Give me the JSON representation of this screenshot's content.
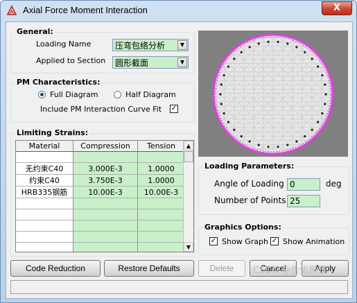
{
  "window": {
    "title": "Axial Force Moment Interaction",
    "close_glyph": "X"
  },
  "general": {
    "legend": "General:",
    "loading_name_label": "Loading Name",
    "loading_name_value": "压弯包络分析",
    "applied_section_label": "Applied to Section",
    "applied_section_value": "圆形截面"
  },
  "pm": {
    "legend": "PM Characteristics:",
    "full_label": "Full Diagram",
    "half_label": "Half Diagram",
    "selected": "full",
    "include_label": "Include PM Interaction Curve Fit",
    "include_checked": true
  },
  "strains": {
    "legend": "Limiting Strains:",
    "headers": [
      "Material",
      "Compression",
      "Tension"
    ],
    "rows": [
      [
        "",
        "",
        ""
      ],
      [
        "无约束C40",
        "3.000E-3",
        "1.0000"
      ],
      [
        "约束C40",
        "3.750E-3",
        "1.0000"
      ],
      [
        "HRB335钢筋",
        "10.00E-3",
        "10.00E-3"
      ],
      [
        "",
        "",
        ""
      ],
      [
        "",
        "",
        ""
      ],
      [
        "",
        "",
        ""
      ],
      [
        "",
        "",
        ""
      ],
      [
        "",
        "",
        ""
      ]
    ]
  },
  "loading_params": {
    "legend": "Loading Parameters:",
    "angle_label": "Angle of Loading",
    "angle_value": "0",
    "angle_unit": "deg",
    "points_label": "Number of Points",
    "points_value": "25"
  },
  "graphics": {
    "legend": "Graphics Options:",
    "show_graph_label": "Show Graph",
    "show_graph_checked": true,
    "show_anim_label": "Show Animation",
    "show_anim_checked": true
  },
  "buttons": {
    "code_reduction": "Code Reduction",
    "restore_defaults": "Restore Defaults",
    "delete": "Delete",
    "cancel": "Cancel",
    "apply": "Apply"
  },
  "watermark": "CSDN @佐佑思维",
  "colors": {
    "field_bg": "#c9f0c9",
    "ring": "#e040e0",
    "preview_bg": "#808080"
  }
}
